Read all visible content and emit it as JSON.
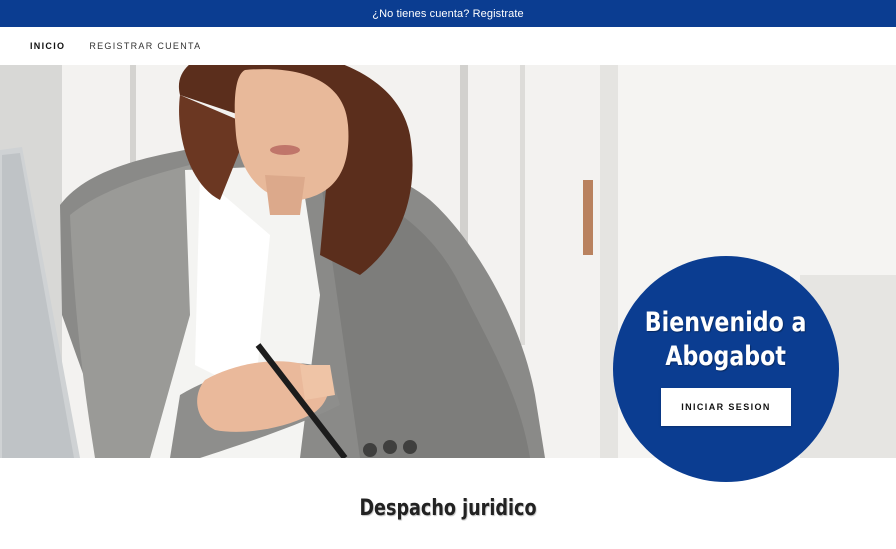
{
  "announcement": {
    "text": "¿No tienes cuenta? Registrate"
  },
  "nav": {
    "items": [
      {
        "label": "INICIO",
        "active": true
      },
      {
        "label": "REGISTRAR CUENTA",
        "active": false
      }
    ]
  },
  "hero": {
    "image_icon": "woman-writing-photo",
    "welcome_line1": "Bienvenido a",
    "welcome_line2": "Abogabot",
    "login_label": "INICIAR SESION"
  },
  "section": {
    "title": "Despacho juridico"
  },
  "colors": {
    "brand_blue": "#0b3d91",
    "white": "#ffffff"
  }
}
